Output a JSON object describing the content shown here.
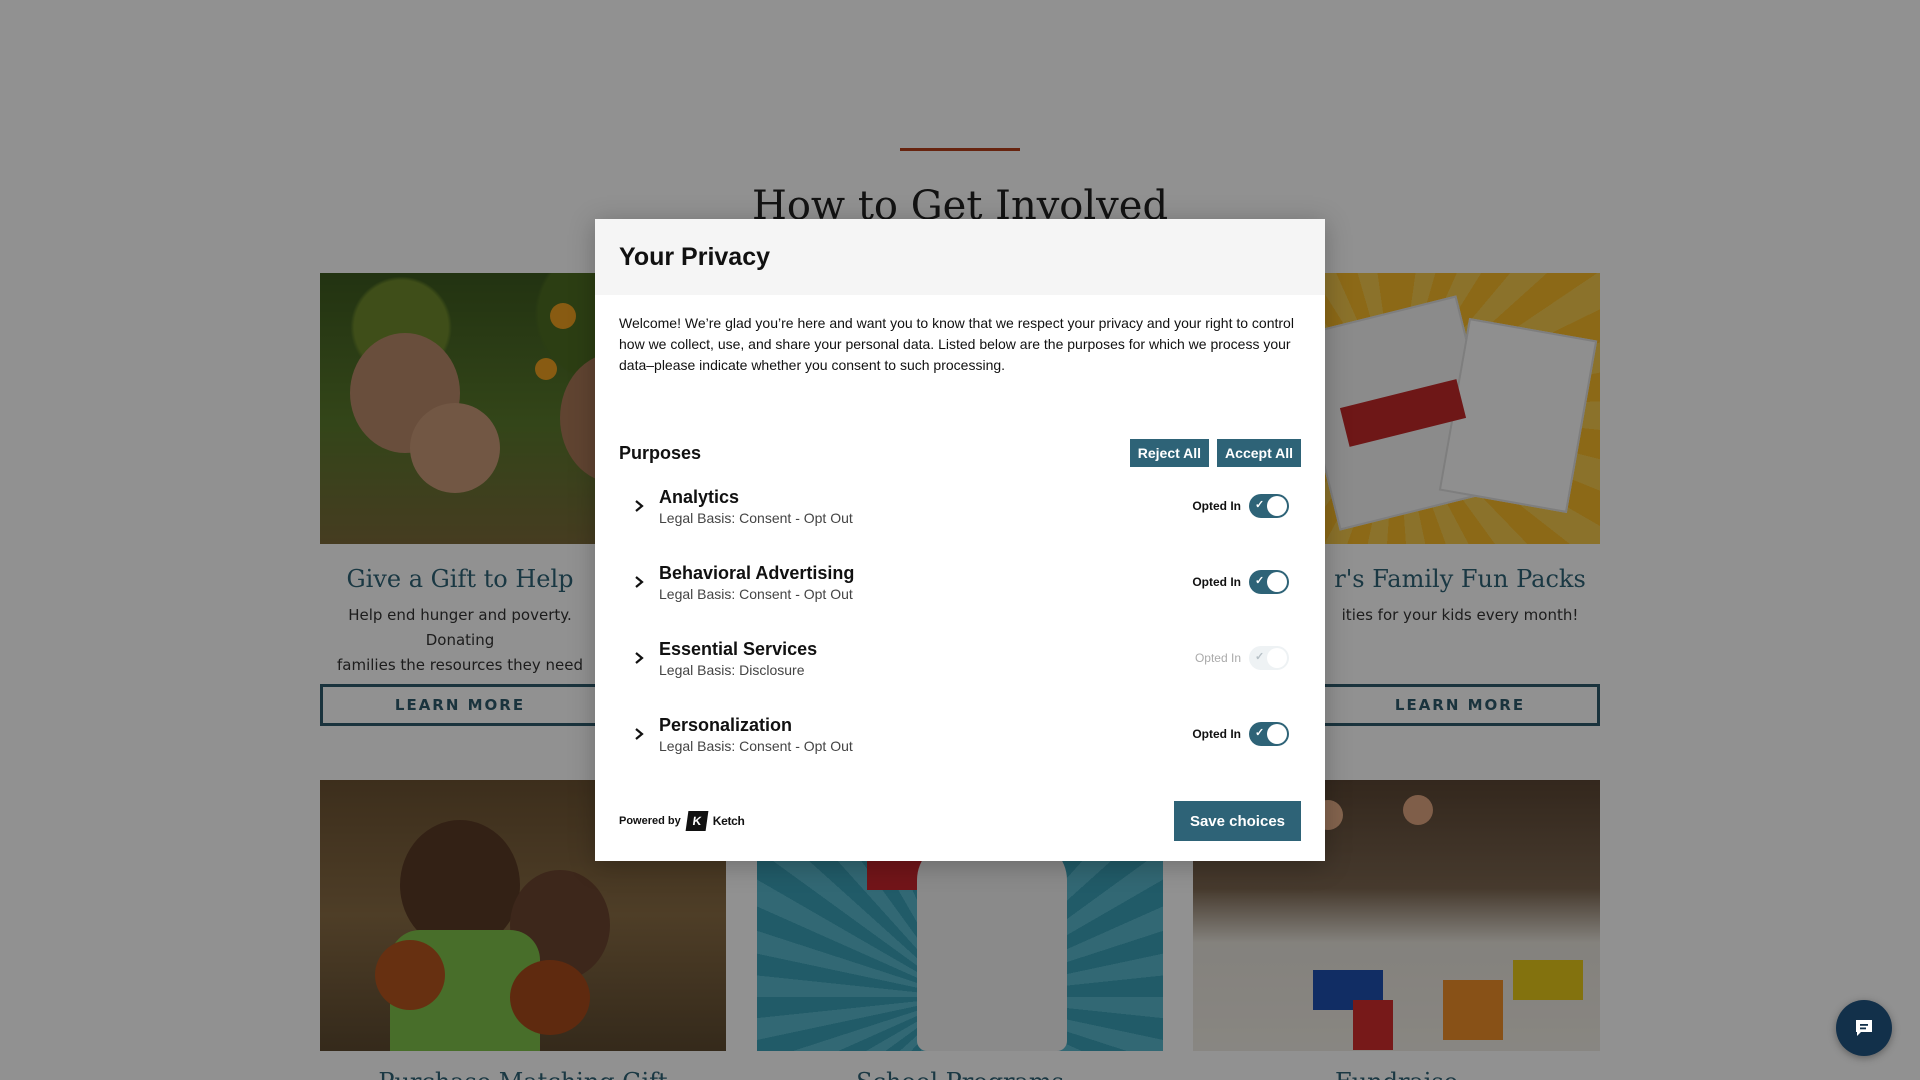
{
  "page": {
    "section_title": "How to Get Involved",
    "cards": [
      {
        "title": "Give a Gift to Help",
        "description_line1": "Help end hunger and poverty. Donating",
        "description_line2": "families the resources they need",
        "button": "LEARN MORE"
      },
      {
        "title": "r's Family Fun Packs",
        "description_line1": "ities for your kids every month!",
        "description_line2": "",
        "button": "LEARN MORE"
      }
    ],
    "bottom_titles": [
      "Purchase Matching Gift",
      "School Programs",
      "Fundraise"
    ]
  },
  "modal": {
    "title": "Your Privacy",
    "intro": "Welcome! We’re glad you’re here and want you to know that we respect your privacy and your right to control how we collect, use, and share your personal data. Listed below are the purposes for which we process your data–please indicate whether you consent to such processing.",
    "purposes_heading": "Purposes",
    "reject_all": "Reject All",
    "accept_all": "Accept All",
    "purposes": [
      {
        "name": "Analytics",
        "basis": "Legal Basis: Consent - Opt Out",
        "status": "Opted In",
        "enabled": true
      },
      {
        "name": "Behavioral Advertising",
        "basis": "Legal Basis: Consent - Opt Out",
        "status": "Opted In",
        "enabled": true
      },
      {
        "name": "Essential Services",
        "basis": "Legal Basis: Disclosure",
        "status": "Opted In",
        "enabled": false
      },
      {
        "name": "Personalization",
        "basis": "Legal Basis: Consent - Opt Out",
        "status": "Opted In",
        "enabled": true
      }
    ],
    "powered_by": "Powered by",
    "brand": "Ketch",
    "save": "Save choices"
  },
  "colors": {
    "accent": "#2e6377",
    "overlay": "rgba(0,0,0,0.43)",
    "rule": "#b5401c",
    "chat": "#12304a"
  },
  "icons": {
    "chevron": "chevron-right-icon",
    "check": "check-icon",
    "chat": "chat-bubble-icon"
  }
}
